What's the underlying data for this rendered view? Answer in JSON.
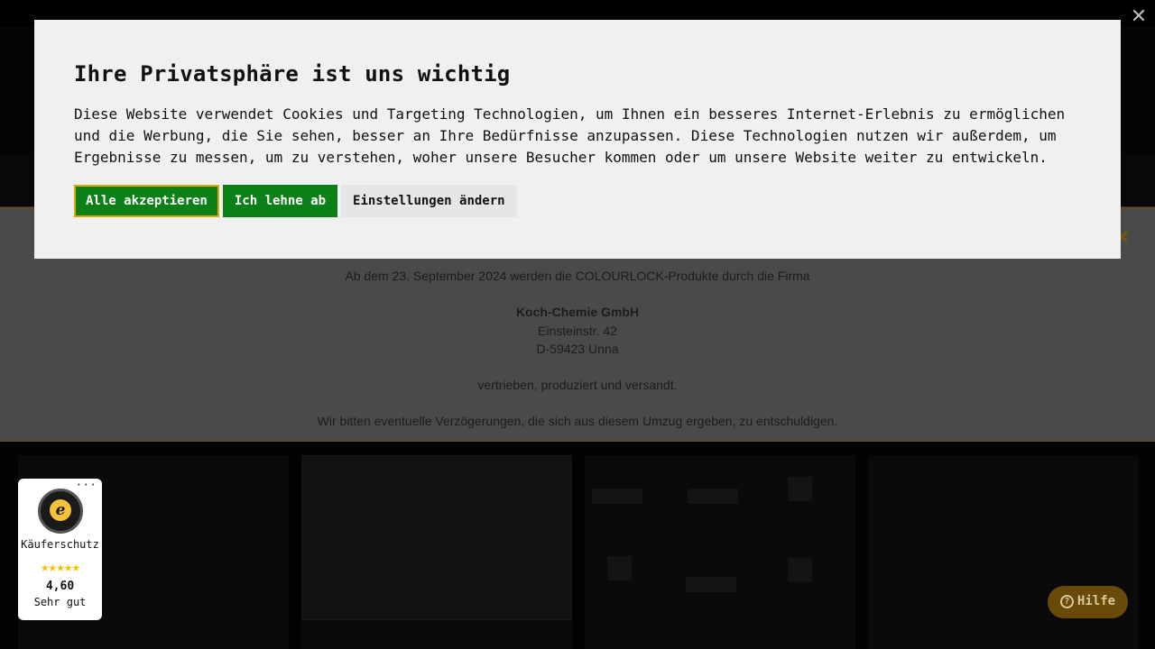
{
  "background": {
    "notice": {
      "line1": "Ab dem 23. September 2024 werden die COLOURLOCK-Produkte durch die Firma",
      "company": "Koch-Chemie GmbH",
      "street": "Einsteinstr. 42",
      "city": "D-59423 Unna",
      "line2": "vertrieben, produziert und versandt.",
      "line3": "Wir bitten eventuelle Verzögerungen, die sich aus diesem Umzug ergeben, zu entschuldigen.",
      "close_icon": "×"
    }
  },
  "cookie_banner": {
    "title": "Ihre Privatsphäre ist uns wichtig",
    "description": "Diese Website verwendet Cookies und Targeting Technologien, um Ihnen ein besseres Internet-Erlebnis zu ermöglichen und die Werbung, die Sie sehen, besser an Ihre Bedürfnisse anzupassen. Diese Technologien nutzen wir außerdem, um Ergebnisse zu messen, um zu verstehen, woher unsere Besucher kommen oder um unsere Website weiter zu entwickeln.",
    "accept_label": "Alle akzeptieren",
    "reject_label": "Ich lehne ab",
    "settings_label": "Einstellungen ändern",
    "colors": {
      "accept": "#0a8016",
      "focus_outline": "#e0a800",
      "background": "#f0f0f0"
    }
  },
  "overlay_close_icon": "✕",
  "trusted_shops": {
    "more": "···",
    "seal_letter": "e",
    "label": "Käuferschutz",
    "stars": "★★★★★",
    "score": "4,60",
    "rating_text": "Sehr gut"
  },
  "help": {
    "icon": "?",
    "label": "Hilfe"
  }
}
